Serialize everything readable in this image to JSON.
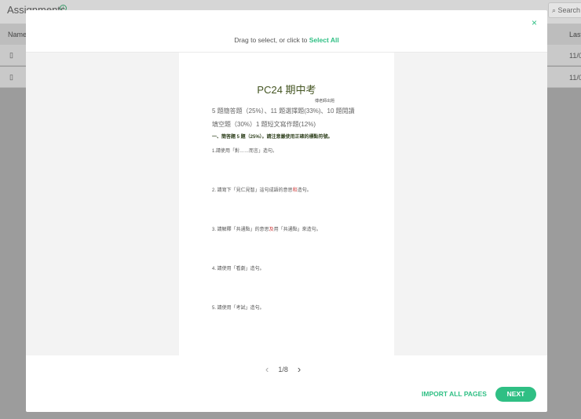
{
  "background": {
    "title": "Assignments",
    "search_placeholder": "Search",
    "col_name": "Name",
    "col_last": "Last",
    "rows": [
      {
        "date": "11/0"
      },
      {
        "date": "11/0"
      }
    ]
  },
  "modal": {
    "hint_prefix": "Drag to select, or click to ",
    "select_all": "Select All",
    "close": "×",
    "page": {
      "title": "PC24 期中考",
      "note": "傅老師出題",
      "line1": "5 題簡答題（25%）、11 題選擇題(33%)、10 題閱讀",
      "line2": "填空題（30%）1 題短文寫作題(12%)",
      "section": "一、簡答題 5 題（25%）。請注意嚴使用正確的標點符號。",
      "q1": "1.請使用「對……而言」造句。",
      "q2a": "2. 請寫下「見仁見智」這句成語的意思",
      "q2r": "和",
      "q2b": "造句。",
      "q3a": "3. 請解釋「共通點」的意思",
      "q3r": "及",
      "q3b": "用「共通點」來造句。",
      "q4": "4. 請使用「看劇」造句。",
      "q5": "5. 請使用「考試」造句。"
    },
    "pager": {
      "prev": "‹",
      "label": "1/8",
      "next": "›"
    },
    "import_all": "IMPORT ALL PAGES",
    "next_button": "NEXT"
  }
}
